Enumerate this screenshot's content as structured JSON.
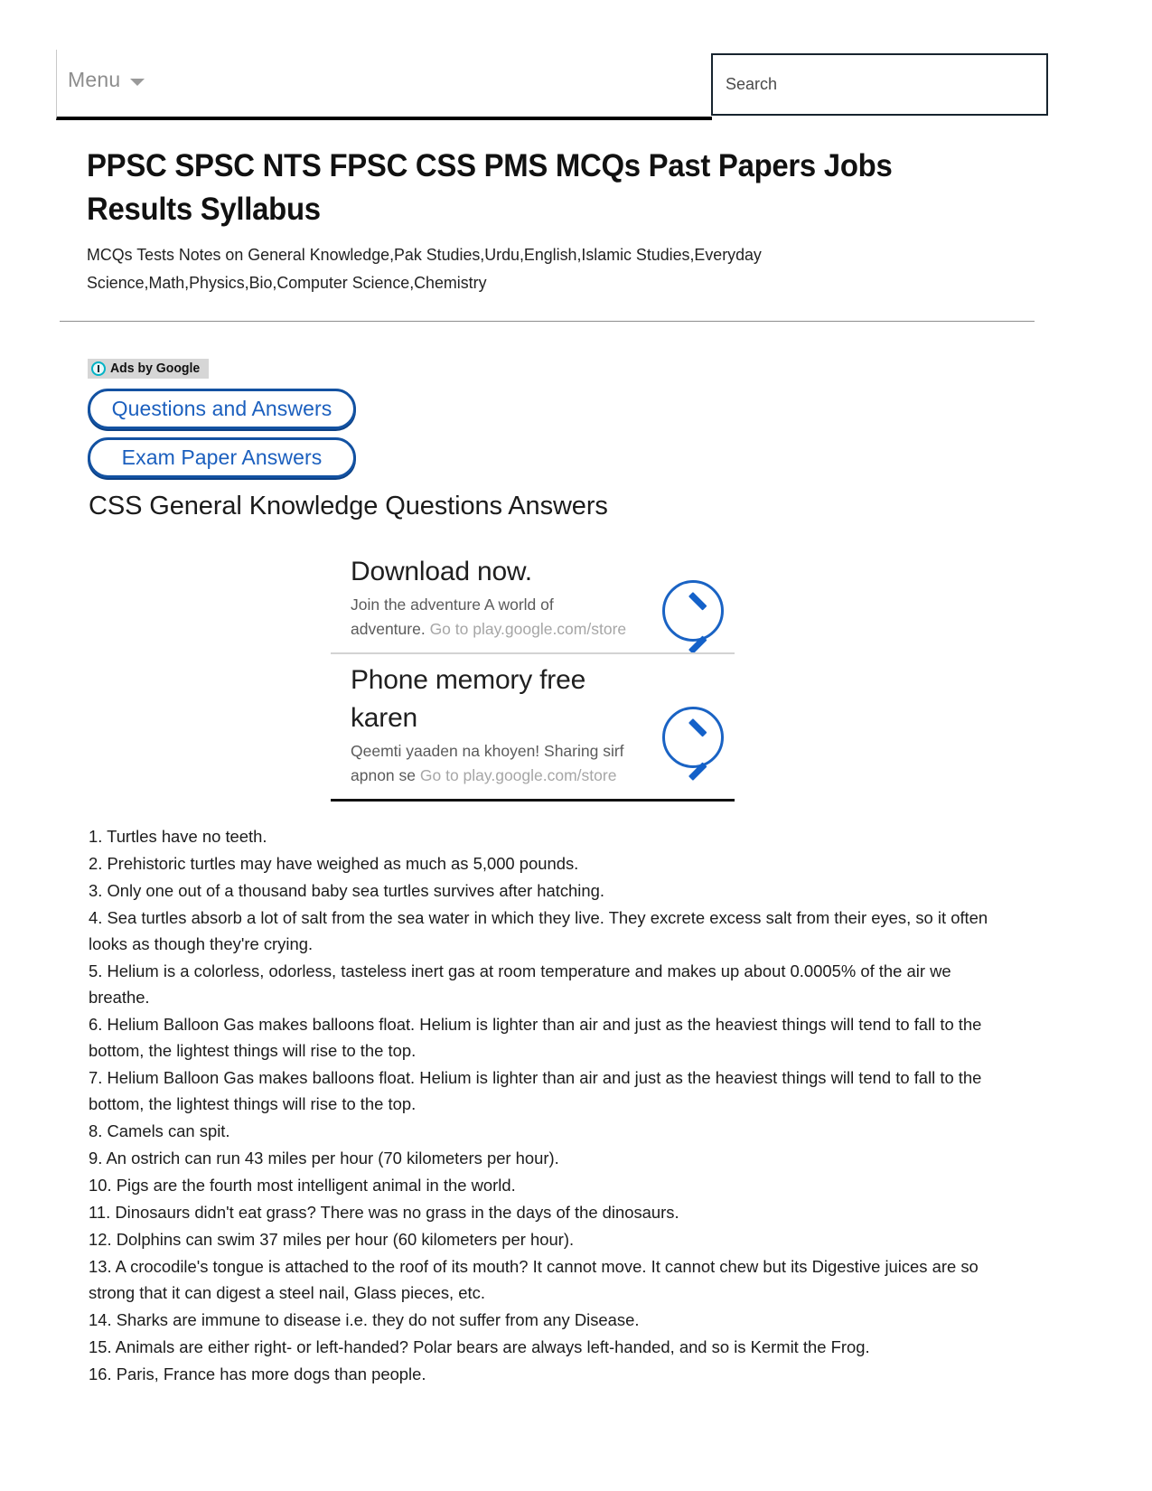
{
  "topbar": {
    "menu_label": "Menu",
    "menu_caret_icon": "chevron-down-icon",
    "search_placeholder": "Search",
    "search_value": ""
  },
  "site_header": {
    "title": "PPSC SPSC NTS FPSC CSS PMS MCQs Past Papers Jobs Results Syllabus",
    "tagline": "MCQs Tests Notes on General Knowledge,Pak Studies,Urdu,English,Islamic Studies,Everyday Science,Math,Physics,Bio,Computer Science,Chemistry"
  },
  "ads_badge": {
    "label": "Ads by Google",
    "info_icon": "info-circle-icon",
    "icon_color": "#00b3c6",
    "background": "#d6d6d6"
  },
  "ad_links": [
    {
      "label": "Questions and Answers"
    },
    {
      "label": "Exam Paper Answers"
    }
  ],
  "section": {
    "heading": "CSS General Knowledge Questions Answers"
  },
  "ad_unit": {
    "accent_color": "#1461c9",
    "ads": [
      {
        "headline": "Download now.",
        "description": "Join the adventure A world of adventure. ",
        "url_text": "Go to play.google.com/store",
        "arrow_icon": "chevron-right-circle-icon"
      },
      {
        "headline": "Phone memory free karen",
        "description": "Qeemti yaaden na khoyen! Sharing sirf apnon se ",
        "url_text": "Go to play.google.com/store",
        "arrow_icon": "chevron-right-circle-icon"
      }
    ]
  },
  "facts": [
    "1. Turtles have no teeth.",
    "2. Prehistoric turtles may have weighed as much as 5,000 pounds.",
    "3. Only one out of a thousand baby sea turtles survives after hatching.",
    "4. Sea turtles absorb a lot of salt from the sea water in which they live. They excrete excess salt from their eyes, so it often looks as though they're crying.",
    "5. Helium is a colorless, odorless, tasteless inert gas at room temperature and makes up about 0.0005% of the air we breathe.",
    "6. Helium Balloon Gas makes balloons float. Helium is lighter than air and just as the heaviest things will tend to fall to the bottom, the lightest things will rise to the top.",
    "7. Helium Balloon Gas makes balloons float. Helium is lighter than air and just as the heaviest things will tend to fall to the bottom, the lightest things will rise to the top.",
    "8. Camels can spit.",
    "9. An ostrich can run 43 miles per hour (70 kilometers per hour).",
    "10. Pigs are the fourth most intelligent animal in the world.",
    "11. Dinosaurs didn't eat grass? There was no grass in the days of the dinosaurs.",
    "12. Dolphins can swim 37 miles per hour (60 kilometers per hour).",
    "13. A crocodile's tongue is attached to the roof of its mouth? It cannot move. It cannot chew but its Digestive juices are so strong that it can digest a steel nail, Glass pieces, etc.",
    "14. Sharks are immune to disease i.e. they do not suffer from any Disease.",
    "15. Animals are either right- or left-handed? Polar bears are always left-handed, and so is Kermit the Frog.",
    "16. Paris, France has more dogs than people."
  ]
}
